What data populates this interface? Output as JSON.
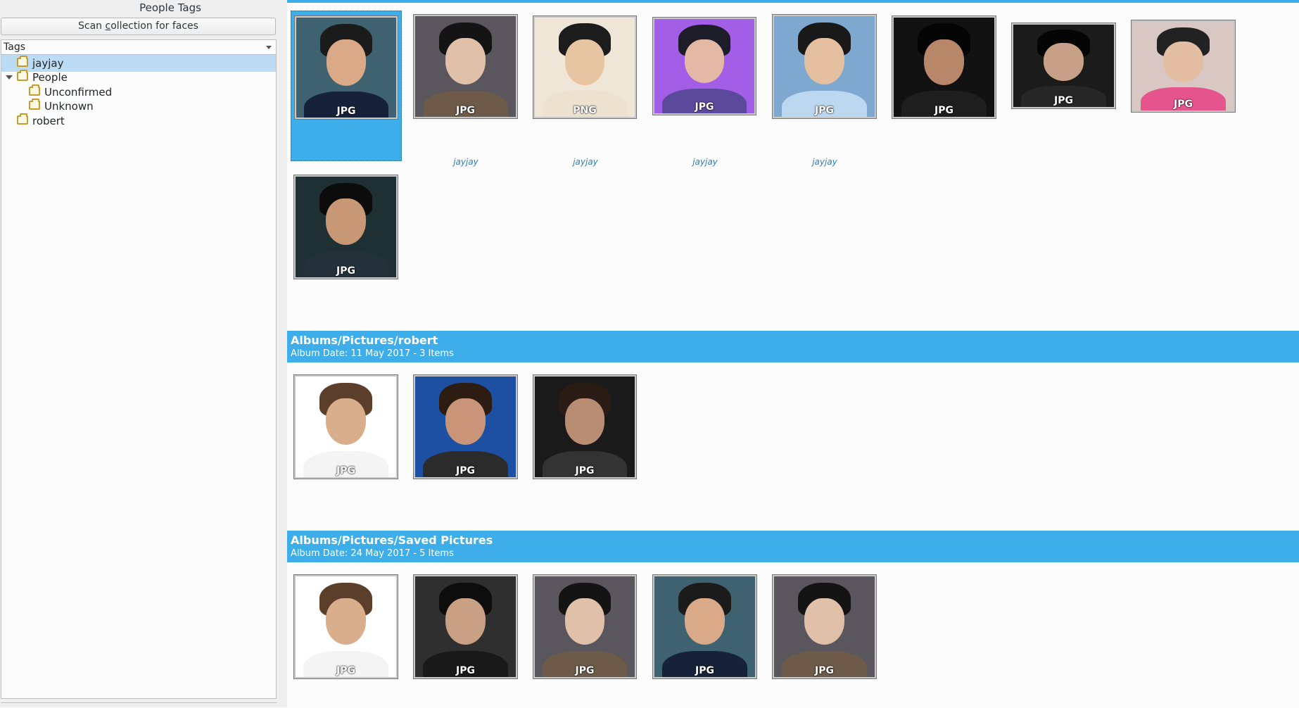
{
  "left_panel": {
    "title": "People Tags",
    "scan_button": {
      "before": "Scan ",
      "mnemonic": "c",
      "after": "ollection for faces"
    },
    "tags_combo": "Tags",
    "tree": [
      {
        "label": "jayjay",
        "selected": true,
        "icon": "folder-icon"
      },
      {
        "label": "People",
        "expanded": true,
        "icon": "folder-icon"
      },
      {
        "label": "Unconfirmed",
        "icon": "folder-icon"
      },
      {
        "label": "Unknown",
        "icon": "folder-icon"
      },
      {
        "label": "robert",
        "icon": "folder-icon"
      }
    ]
  },
  "colors": {
    "accent": "#3daee9",
    "selection": "#bcdcf5",
    "label_link": "#2980b9"
  },
  "group1": {
    "items": [
      {
        "ext": "JPG",
        "label": "",
        "selected": true
      },
      {
        "ext": "JPG",
        "label": "jayjay"
      },
      {
        "ext": "PNG",
        "label": "jayjay"
      },
      {
        "ext": "JPG",
        "label": "jayjay"
      },
      {
        "ext": "JPG",
        "label": "jayjay"
      },
      {
        "ext": "JPG",
        "label": ""
      },
      {
        "ext": "JPG",
        "label": ""
      },
      {
        "ext": "JPG",
        "label": ""
      },
      {
        "ext": "JPG",
        "label": ""
      }
    ]
  },
  "albums": [
    {
      "title": "Albums/Pictures/robert",
      "subtitle": "Album Date: 11 May 2017 - 3 Items",
      "items": [
        {
          "ext": "JPG"
        },
        {
          "ext": "JPG"
        },
        {
          "ext": "JPG"
        }
      ]
    },
    {
      "title": "Albums/Pictures/Saved Pictures",
      "subtitle": "Album Date: 24 May 2017 - 5 Items",
      "items": [
        {
          "ext": "JPG"
        },
        {
          "ext": "JPG"
        },
        {
          "ext": "JPG"
        },
        {
          "ext": "JPG"
        },
        {
          "ext": "JPG"
        }
      ]
    }
  ]
}
